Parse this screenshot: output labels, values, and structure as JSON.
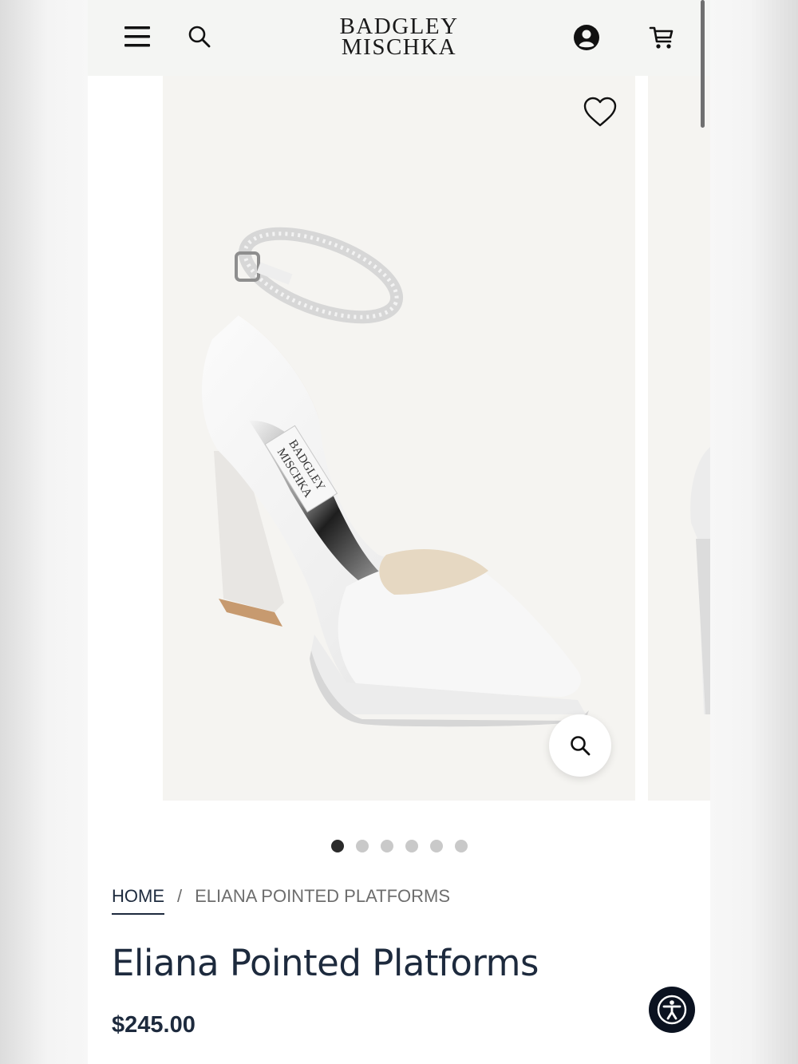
{
  "header": {
    "logo_line1": "BADGLEY",
    "logo_line2": "MISCHKA",
    "icons": [
      "menu-icon",
      "search-icon",
      "account-icon",
      "cart-icon"
    ]
  },
  "gallery": {
    "slide_count": 6,
    "active_slide": 1,
    "shoe_label_line1": "BADGLEY",
    "shoe_label_line2": "MISCHKA",
    "icons": [
      "heart-icon",
      "zoom-icon"
    ]
  },
  "breadcrumb": {
    "home": "HOME",
    "separator": "/",
    "current": "ELIANA POINTED PLATFORMS"
  },
  "product": {
    "title": "Eliana Pointed Platforms",
    "price": "$245.00"
  },
  "colors": {
    "navy": "#1d2a3d",
    "header_bg": "#f4f5f3",
    "image_bg": "#f5f4f1",
    "a11y_bg": "#0b1220"
  }
}
